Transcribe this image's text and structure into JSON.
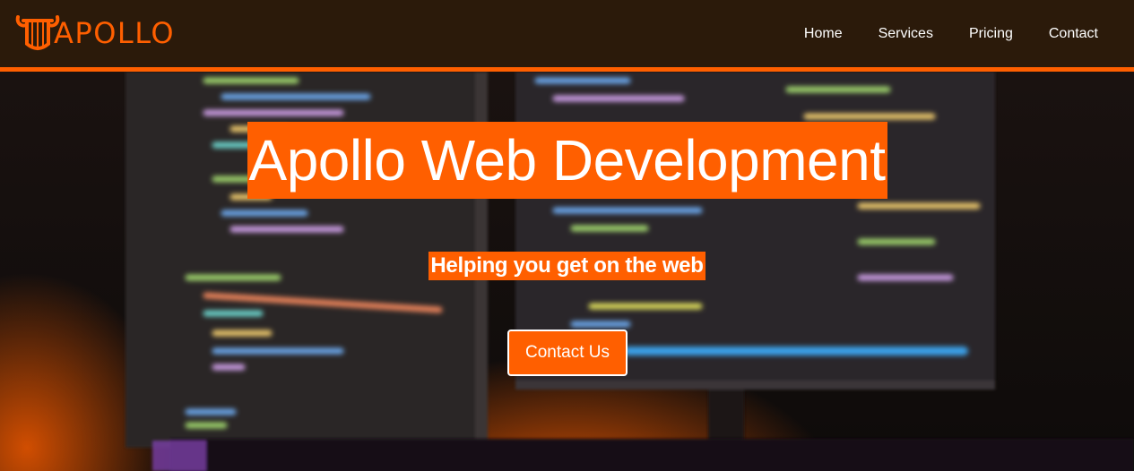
{
  "brand": {
    "name": "APOLLO",
    "icon": "lyre-icon",
    "color": "#ff5f00"
  },
  "nav": {
    "items": [
      {
        "label": "Home"
      },
      {
        "label": "Services"
      },
      {
        "label": "Pricing"
      },
      {
        "label": "Contact"
      }
    ]
  },
  "hero": {
    "title": "Apollo Web Development",
    "subtitle": "Helping you get on the web",
    "cta_label": "Contact Us",
    "background": "blurred-code-monitors-image"
  },
  "colors": {
    "accent": "#ff5f00",
    "navbar_bg": "#2b1a0a",
    "text": "#ffffff"
  }
}
